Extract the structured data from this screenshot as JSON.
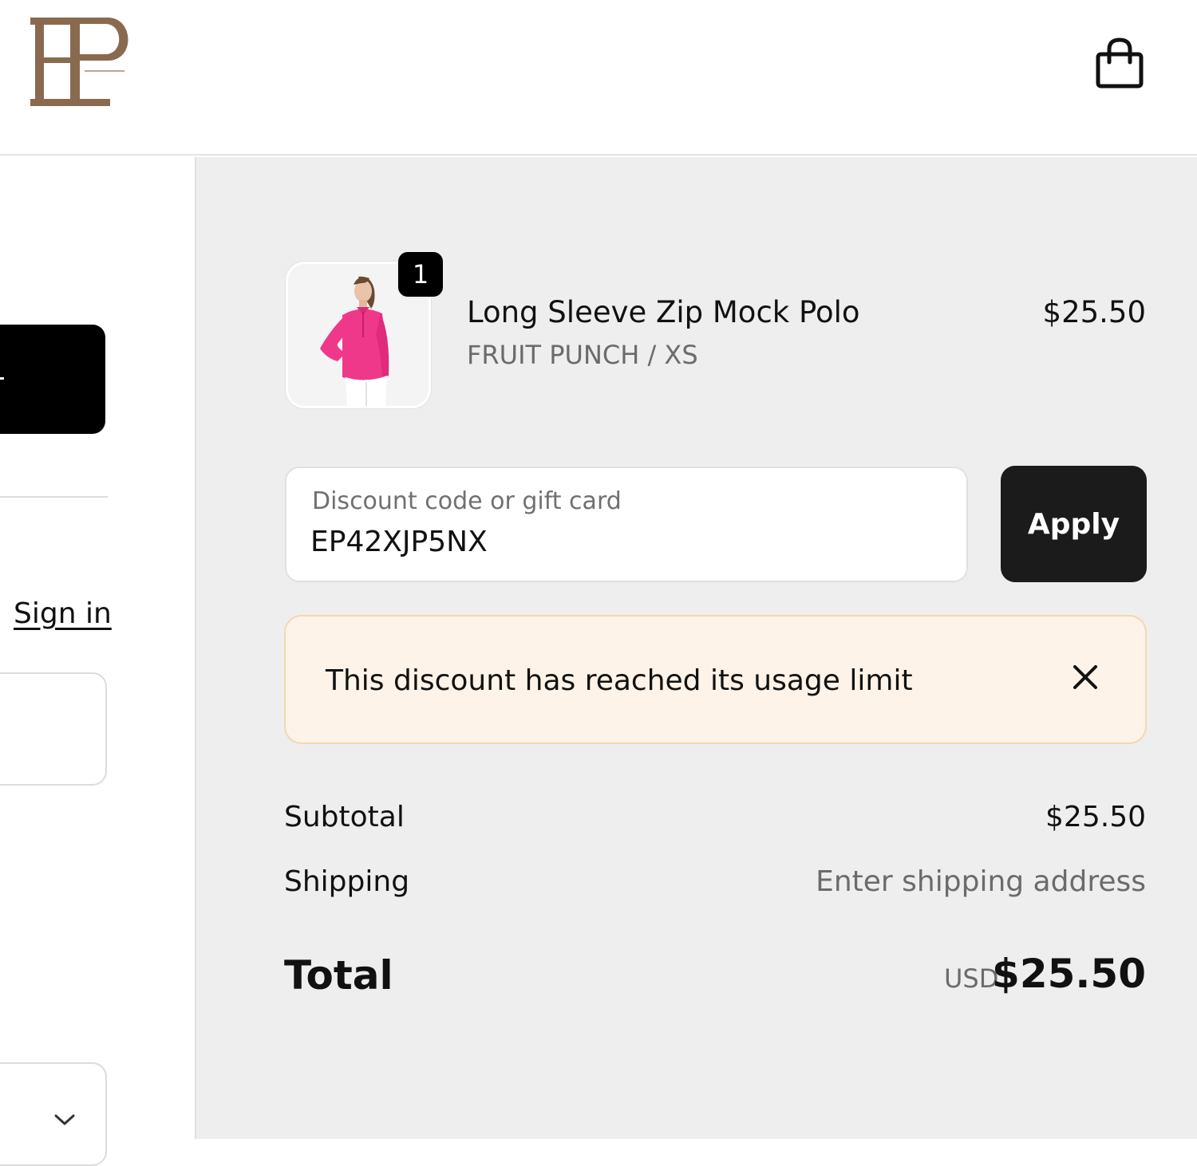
{
  "header": {
    "logo_alt": "EP"
  },
  "left": {
    "sign_in": "Sign in"
  },
  "cart": {
    "item": {
      "name": "Long Sleeve Zip Mock Polo",
      "variant": "FRUIT PUNCH / XS",
      "price": "$25.50",
      "quantity": "1"
    }
  },
  "discount": {
    "label": "Discount code or gift card",
    "value": "EP42XJP5NX",
    "apply_label": "Apply",
    "error_message": "This discount has reached its usage limit"
  },
  "summary": {
    "subtotal_label": "Subtotal",
    "subtotal_value": "$25.50",
    "shipping_label": "Shipping",
    "shipping_value": "Enter shipping address",
    "total_label": "Total",
    "total_currency": "USD",
    "total_value": "$25.50"
  },
  "colors": {
    "logo": "#8a6a4f",
    "summary_bg": "#eeeeee",
    "alert_bg": "#fdf3e8",
    "alert_border": "#f6d6b0",
    "product": "#f0388a"
  },
  "icons": {
    "bag": "shopping-bag-icon",
    "close": "close-icon",
    "chevron": "chevron-down-icon"
  }
}
